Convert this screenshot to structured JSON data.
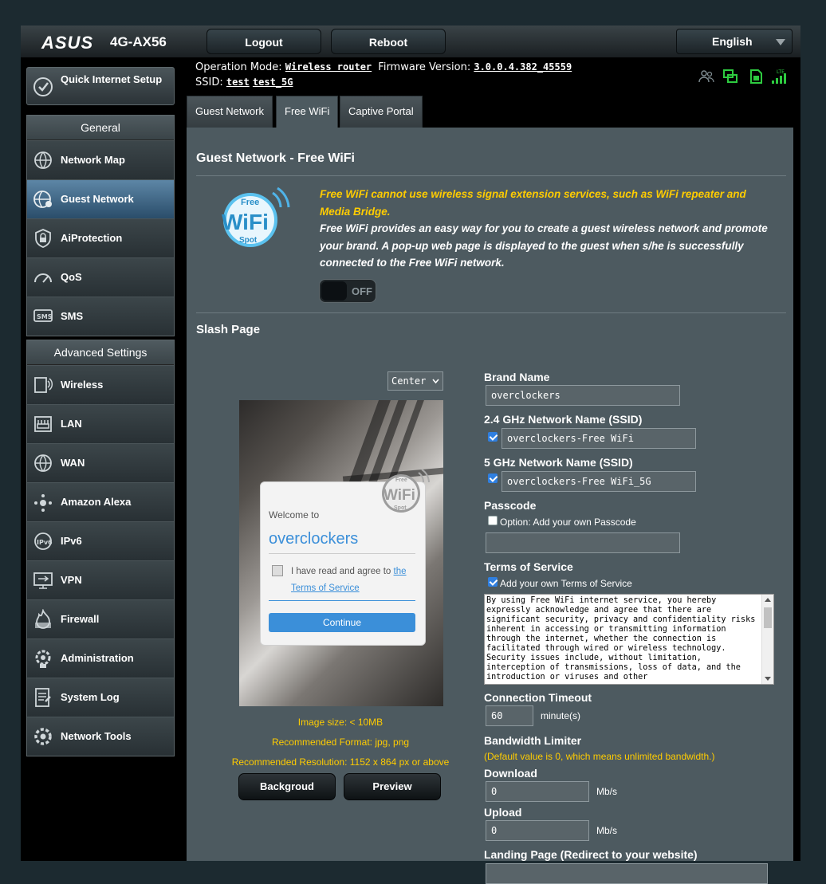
{
  "header": {
    "logo": "ASUS",
    "model": "4G-AX56",
    "logout": "Logout",
    "reboot": "Reboot",
    "language": "English",
    "op_mode_label": "Operation Mode:",
    "op_mode": "Wireless router",
    "fw_label": "Firmware Version:",
    "fw": "3.0.0.4.382_45559",
    "ssid_label": "SSID:",
    "ssid1": "test",
    "ssid2": "test_5G"
  },
  "sidebar": {
    "qis": "Quick Internet Setup",
    "general_title": "General",
    "general": [
      "Network Map",
      "Guest Network",
      "AiProtection",
      "QoS",
      "SMS"
    ],
    "advanced_title": "Advanced Settings",
    "advanced": [
      "Wireless",
      "LAN",
      "WAN",
      "Amazon Alexa",
      "IPv6",
      "VPN",
      "Firewall",
      "Administration",
      "System Log",
      "Network Tools"
    ]
  },
  "tabs": [
    "Guest Network",
    "Free WiFi",
    "Captive Portal"
  ],
  "main": {
    "title": "Guest Network - Free WiFi",
    "warning": "Free WiFi cannot use wireless signal extension services, such as WiFi repeater and Media Bridge.",
    "description": "Free WiFi provides an easy way for you to create a guest wireless network and promote your brand. A pop-up web page is displayed to the guest when s/he is successfully connected to the Free WiFi network.",
    "toggle": "OFF",
    "logo_free": "Free",
    "logo_wifi": "WiFi",
    "logo_spot": "Spot",
    "splash_title": "Slash Page",
    "align": "Center",
    "preview": {
      "welcome": "Welcome to",
      "brand": "overclockers",
      "agree_text": "I have read and agree to",
      "agree_link1": "the",
      "agree_link2": "Terms of Service",
      "continue": "Continue"
    },
    "image_size": "Image size: < 10MB",
    "format": "Recommended Format: jpg, png",
    "resolution": "Recommended Resolution: 1152 x 864 px or above",
    "background_btn": "Backgroud",
    "preview_btn": "Preview"
  },
  "form": {
    "brand_label": "Brand Name",
    "brand_value": "overclockers",
    "ssid24_label": "2.4 GHz Network Name (SSID)",
    "ssid24_value": "overclockers-Free WiFi",
    "ssid5_label": "5 GHz Network Name (SSID)",
    "ssid5_value": "overclockers-Free WiFi_5G",
    "passcode_label": "Passcode",
    "passcode_option": "Option: Add your own Passcode",
    "tos_label": "Terms of Service",
    "tos_option": "Add your own Terms of Service",
    "tos_text": "By using Free WiFi internet service, you hereby expressly acknowledge and agree that there are significant security, privacy and confidentiality risks inherent in accessing or transmitting information through the internet, whether the connection is facilitated through wired or wireless technology. Security issues include, without limitation, interception of transmissions, loss of data, and the introduction or viruses and other",
    "timeout_label": "Connection Timeout",
    "timeout_value": "60",
    "timeout_unit": "minute(s)",
    "bw_label": "Bandwidth Limiter",
    "bw_note": "(Default value is 0, which means unlimited bandwidth.)",
    "download_label": "Download",
    "download_value": "0",
    "upload_label": "Upload",
    "upload_value": "0",
    "rate_unit": "Mb/s",
    "landing_label": "Landing Page (Redirect to your website)"
  },
  "colors": {
    "accent_yellow": "#ffcc00",
    "link_blue": "#3b8fd9",
    "status_green": "#2ecc40"
  }
}
